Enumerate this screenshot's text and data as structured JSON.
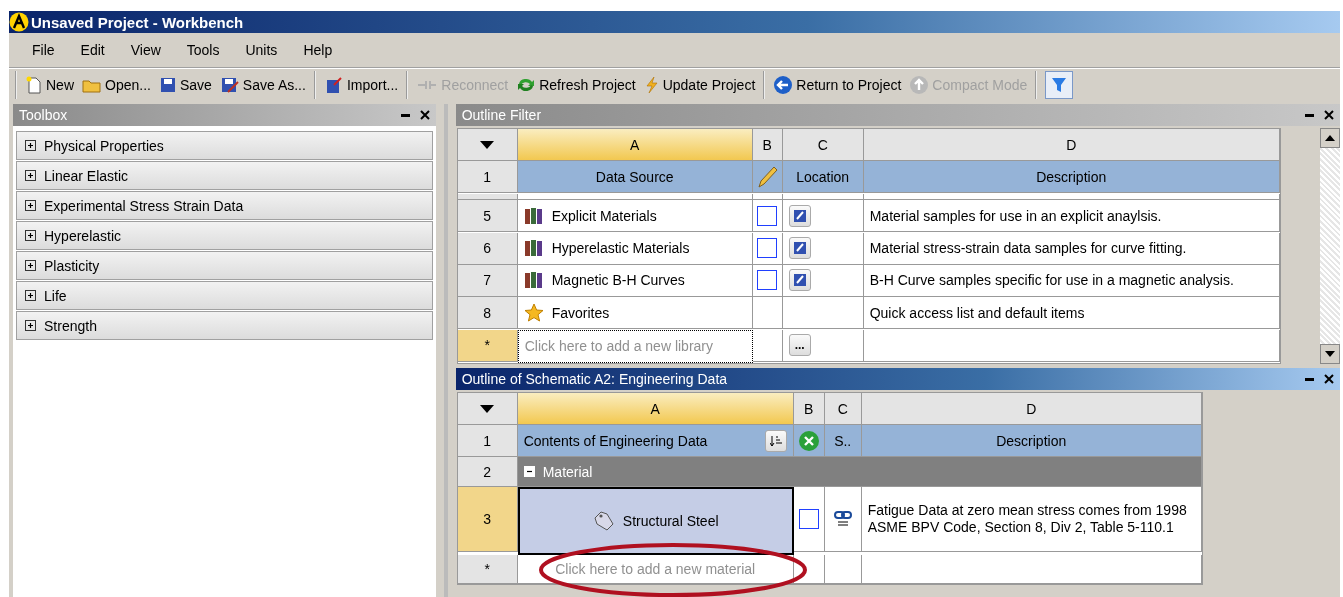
{
  "window": {
    "title": "Unsaved Project - Workbench"
  },
  "menu": [
    "File",
    "Edit",
    "View",
    "Tools",
    "Units",
    "Help"
  ],
  "toolbar": {
    "groups": [
      [
        {
          "label": "New",
          "disabled": false
        },
        {
          "label": "Open...",
          "disabled": false
        },
        {
          "label": "Save",
          "disabled": false
        },
        {
          "label": "Save As...",
          "disabled": false
        }
      ],
      [
        {
          "label": "Import...",
          "disabled": false
        }
      ],
      [
        {
          "label": "Reconnect",
          "disabled": true
        },
        {
          "label": "Refresh Project",
          "disabled": false
        },
        {
          "label": "Update Project",
          "disabled": false
        }
      ],
      [
        {
          "label": "Return to Project",
          "disabled": false
        },
        {
          "label": "Compact Mode",
          "disabled": true
        }
      ]
    ],
    "filter": {
      "on": true
    }
  },
  "toolbox": {
    "title": "Toolbox",
    "items": [
      {
        "label": "Physical Properties",
        "expanded": false
      },
      {
        "label": "Linear Elastic",
        "expanded": false
      },
      {
        "label": "Experimental Stress Strain Data",
        "expanded": false
      },
      {
        "label": "Hyperelastic",
        "expanded": false
      },
      {
        "label": "Plasticity",
        "expanded": false
      },
      {
        "label": "Life",
        "expanded": false
      },
      {
        "label": "Strength",
        "expanded": false
      }
    ]
  },
  "outline_filter": {
    "title": "Outline Filter",
    "columns": [
      "A",
      "B",
      "C",
      "D"
    ],
    "header": {
      "row": "1",
      "data_source": "Data Source",
      "location": "Location",
      "description": "Description"
    },
    "rows": [
      {
        "row": "5",
        "kind": "library",
        "name": "Explicit Materials",
        "checked": false,
        "description": "Material samples for use in an explicit anaylsis."
      },
      {
        "row": "6",
        "kind": "library",
        "name": "Hyperelastic Materials",
        "checked": false,
        "description": "Material stress-strain data samples for curve fitting."
      },
      {
        "row": "7",
        "kind": "library",
        "name": "Magnetic B-H Curves",
        "checked": false,
        "description": "B-H Curve samples specific for use in a magnetic analysis."
      },
      {
        "row": "8",
        "kind": "favorite",
        "name": "Favorites",
        "description": "Quick access list and default items"
      }
    ],
    "new_row": {
      "row": "*",
      "placeholder": "Click here to add a new library",
      "browse": "..."
    }
  },
  "schematic_outline": {
    "title": "Outline of Schematic A2: Engineering Data",
    "columns": [
      "A",
      "B",
      "C",
      "D"
    ],
    "header": {
      "row": "1",
      "contents": "Contents of Engineering Data",
      "column_c": "S..",
      "description": "Description"
    },
    "group": {
      "row": "2",
      "label": "Material",
      "expanded": true
    },
    "rows": [
      {
        "row": "3",
        "name": "Structural Steel",
        "selected": true,
        "checked": false,
        "description": "Fatigue Data at zero mean stress comes from 1998 ASME BPV Code, Section 8, Div 2, Table 5-110.1"
      }
    ],
    "new_row": {
      "row": "*",
      "placeholder": "Click here to add a new material"
    }
  }
}
